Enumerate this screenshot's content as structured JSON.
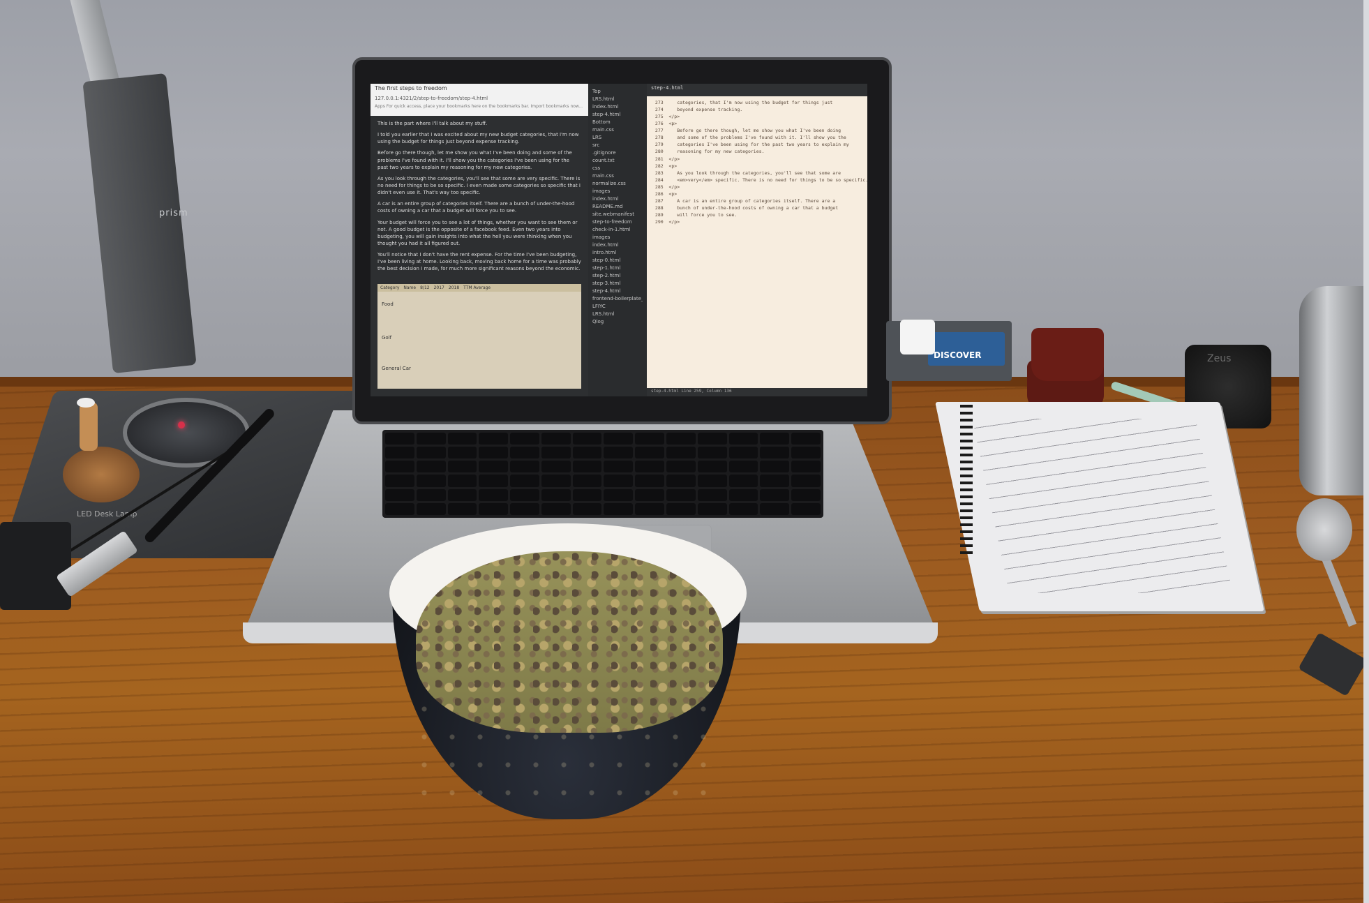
{
  "scene": {
    "description_free": true
  },
  "lamp": {
    "brand": "prism",
    "label": "LED Desk Lamp"
  },
  "browser": {
    "tab_title": "The first steps to freedom",
    "url": "127.0.0.1:4321/2/step-to-freedom/step-4.html",
    "bookmarks_hint": "Apps   For quick access, place your bookmarks here on the bookmarks bar.   Import bookmarks now..."
  },
  "article": {
    "paragraphs": [
      "This is the part where I'll talk about my stuff.",
      "I told you earlier that I was excited about my new budget categories, that I'm now using the budget for things just beyond expense tracking.",
      "Before go there though, let me show you what I've been doing and some of the problems I've found with it. I'll show you the categories I've been using for the past two years to explain my reasoning for my new categories.",
      "As you look through the categories, you'll see that some are very specific. There is no need for things to be so specific. I even made some categories so specific that I didn't even use it. That's way too specific.",
      "A car is an entire group of categories itself. There are a bunch of under-the-hood costs of owning a car that a budget will force you to see.",
      "Your budget will force you to see a lot of things, whether you want to see them or not. A good budget is the opposite of a facebook feed. Even two years into budgeting, you will gain insights into what the hell you were thinking when you thought you had it all figured out.",
      "You'll notice that I don't have the rent expense. For the time I've been budgeting, I've been living at home. Looking back, moving back home for a time was probably the best decision I made, for much more significant reasons beyond the economic."
    ],
    "table_headers": [
      "Category",
      "Name",
      "8/12",
      "2017",
      "2018",
      "TTM Average"
    ],
    "table_groups": [
      "Food",
      "Golf",
      "General Car"
    ]
  },
  "file_tree": {
    "top": [
      "Top",
      "LRS.html",
      "index.html",
      "step-4.html"
    ],
    "bottom": [
      "Bottom",
      "main.css"
    ],
    "items": [
      "LRS",
      "src",
      ".gitignore",
      "count.txt",
      "css",
      "main.css",
      "normalize.css",
      "images",
      "index.html",
      "README.md",
      "site.webmanifest",
      "step-to-freedom",
      "check-in-1.html",
      "images",
      "index.html",
      "intro.html",
      "step-0.html",
      "step-1.html",
      "step-2.html",
      "step-3.html",
      "step-4.html",
      "frontend-boilerplate_v6.0.1",
      "LFIYC",
      "LRS.html",
      "Qlog"
    ]
  },
  "editor": {
    "tab": "step-4.html",
    "line_numbers": [
      "273",
      "274",
      "275",
      "276",
      "277",
      "278",
      "279",
      "280",
      "281",
      "282",
      "283",
      "284",
      "285",
      "286",
      "287",
      "288",
      "289",
      "290"
    ],
    "code": [
      "   categories, that I'm now using the budget for things just",
      "   beyond expense tracking.",
      "</p>",
      "<p>",
      "   Before go there though, let me show you what I've been doing",
      "   and some of the problems I've found with it. I'll show you the",
      "   categories I've been using for the past two years to explain my",
      "   reasoning for my new categories.",
      "</p>",
      "<p>",
      "   As you look through the categories, you'll see that some are",
      "   <em>very</em> specific. There is no need for things to be so specific.",
      "</p>",
      "<p>",
      "   A car is an entire group of categories itself. There are a",
      "   bunch of under-the-hood costs of owning a car that a budget",
      "   will force you to see.",
      "</p>"
    ],
    "status": "step-4.html   Line 259, Column 136"
  },
  "card": {
    "brand": "DISCOVER"
  },
  "grinder": {
    "brand": "Zeus"
  },
  "colors": {
    "wall": "#a3a5ac",
    "desk": "#9b5a20",
    "laptop": "#b9bbbe",
    "bowl_rim": "#f5f3ef",
    "food": "#8c874f"
  }
}
